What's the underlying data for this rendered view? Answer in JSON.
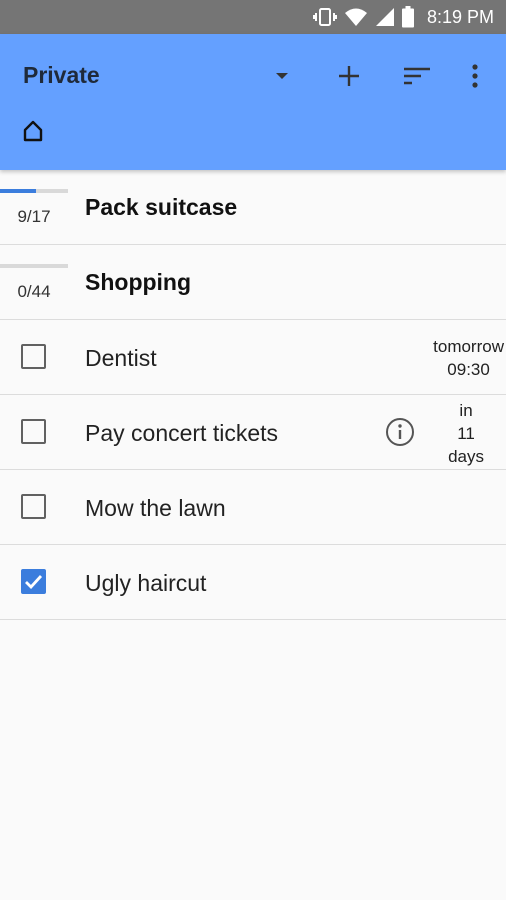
{
  "status_bar": {
    "time": "8:19 PM",
    "icons": [
      "vibrate-icon",
      "wifi-icon",
      "cell-signal-icon",
      "battery-icon"
    ]
  },
  "app_bar": {
    "title": "Private",
    "background": "#64a0ff",
    "icons": [
      "dropdown-arrow-icon",
      "add-icon",
      "sort-icon",
      "more-vert-icon",
      "home-icon"
    ]
  },
  "lists": [
    {
      "title": "Pack suitcase",
      "progress_text": "9/17",
      "progress_fraction": 0.53
    },
    {
      "title": "Shopping",
      "progress_text": "0/44",
      "progress_fraction": 0.0
    }
  ],
  "tasks": [
    {
      "title": "Dentist",
      "checked": false,
      "due_lines": [
        "tomorrow",
        "09:30"
      ],
      "has_info": false
    },
    {
      "title": "Pay concert tickets",
      "checked": false,
      "due_lines": [
        "in",
        "11",
        "days"
      ],
      "has_info": true
    },
    {
      "title": "Mow the lawn",
      "checked": false,
      "due_lines": [],
      "has_info": false
    },
    {
      "title": "Ugly haircut",
      "checked": true,
      "due_lines": [],
      "has_info": false
    }
  ],
  "colors": {
    "accent": "#3b7ddd",
    "divider": "#dcdcdc",
    "status_bar": "#757575"
  }
}
